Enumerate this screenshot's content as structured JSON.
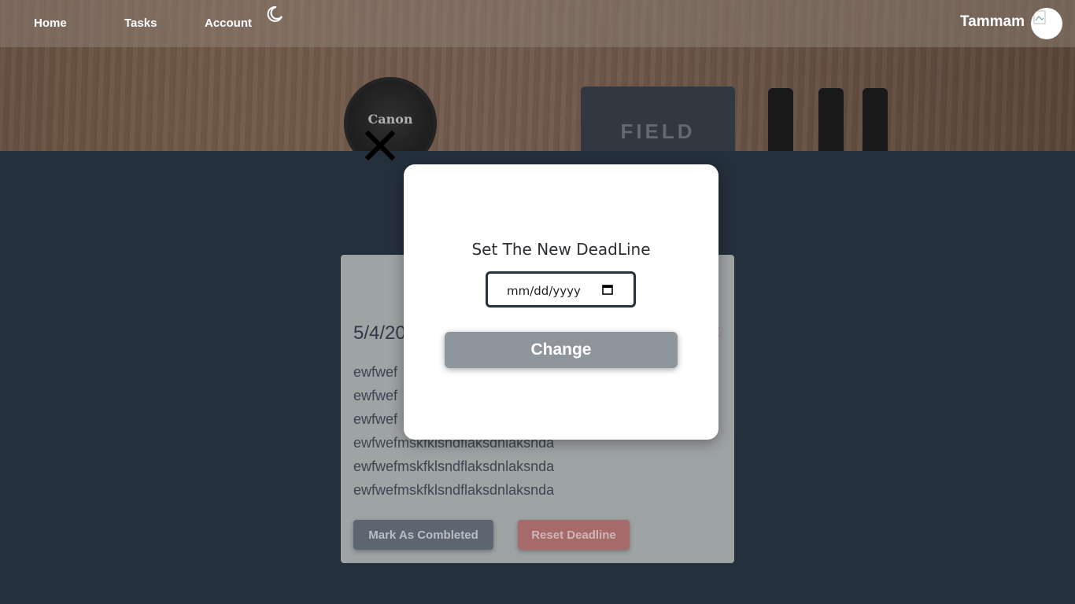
{
  "nav": {
    "home": "Home",
    "tasks": "Tasks",
    "account": "Account",
    "theme_icon": "moon-icon",
    "username": "Tammam"
  },
  "hero": {
    "lens_cap_text": "Canon",
    "notebook_text": "FIELD"
  },
  "task": {
    "date": "5/4/20",
    "lines": [
      "ewfwef",
      "ewfwef",
      "ewfwef",
      "ewfwefmskfklsndflaksdnlaksnda",
      "ewfwefmskfklsndflaksdnlaksnda",
      "ewfwefmskfklsndflaksdnlaksnda"
    ],
    "complete_label": "Mark As Combleted",
    "reset_label": "Reset Deadline"
  },
  "modal": {
    "title": "Set The New DeadLine",
    "date_placeholder": "mm/dd/yyyy",
    "change_label": "Change"
  },
  "colors": {
    "page_bg": "#25303d",
    "modal_bg": "#ffffff",
    "change_button": "#8e959b",
    "reset_button": "#a66a6a"
  }
}
